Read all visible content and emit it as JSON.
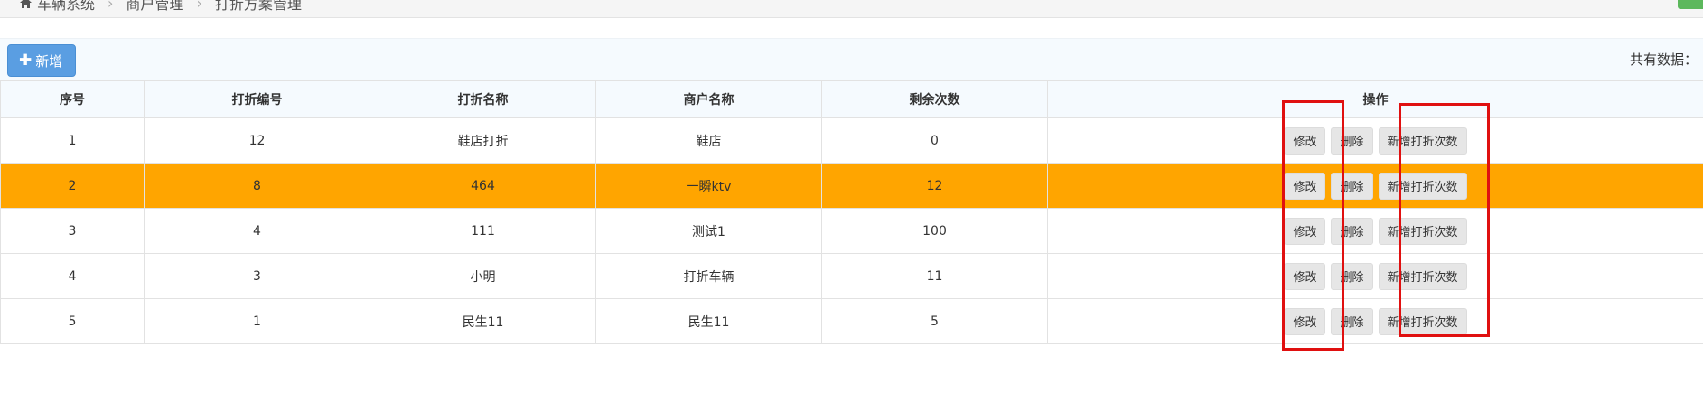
{
  "breadcrumb": {
    "items": [
      "车辆系统",
      "商户管理",
      "打折方案管理"
    ]
  },
  "toolbar": {
    "add_label": "新增",
    "total_label": "共有数据："
  },
  "table": {
    "headers": [
      "序号",
      "打折编号",
      "打折名称",
      "商户名称",
      "剩余次数",
      "操作"
    ],
    "rows": [
      {
        "index": "1",
        "code": "12",
        "name": "鞋店打折",
        "merchant": "鞋店",
        "remaining": "0"
      },
      {
        "index": "2",
        "code": "8",
        "name": "464",
        "merchant": "一瞬ktv",
        "remaining": "12"
      },
      {
        "index": "3",
        "code": "4",
        "name": "111",
        "merchant": "测试1",
        "remaining": "100"
      },
      {
        "index": "4",
        "code": "3",
        "name": "小明",
        "merchant": "打折车辆",
        "remaining": "11"
      },
      {
        "index": "5",
        "code": "1",
        "name": "民生11",
        "merchant": "民生11",
        "remaining": "5"
      }
    ],
    "actions": {
      "edit": "修改",
      "delete": "删除",
      "add_count": "新增打折次数"
    }
  },
  "colors": {
    "highlight_row": "#ffa500",
    "add_button": "#5a9ee2",
    "annotation": "#e01010"
  },
  "icons": {
    "home": "home-icon",
    "add": "plus-icon"
  }
}
